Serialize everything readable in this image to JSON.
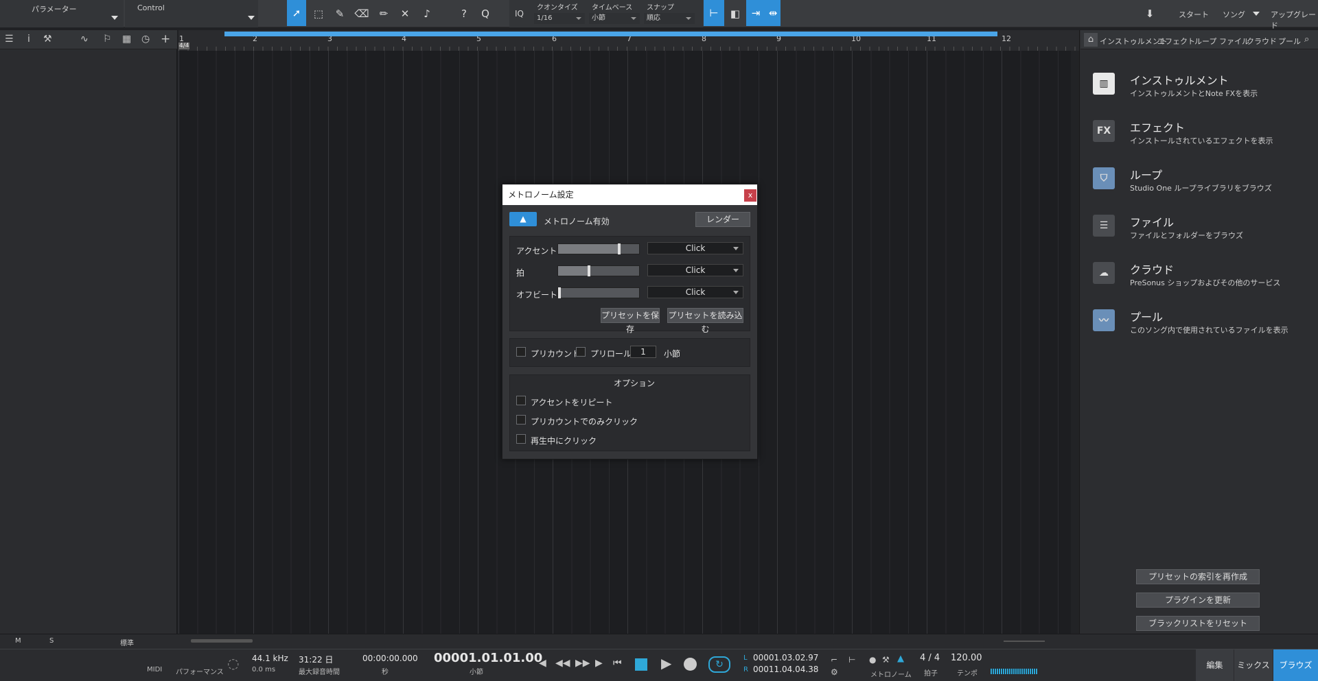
{
  "top": {
    "param_label": "パラメーター",
    "control_label": "Control",
    "iq": "IQ",
    "quantize_label": "クオンタイズ",
    "quantize_value": "1/16",
    "timebase_label": "タイムベース",
    "timebase_value": "小節",
    "snap_label": "スナップ",
    "snap_value": "順応",
    "help": "?",
    "q": "Q",
    "start": "スタート",
    "song": "ソング",
    "upgrade": "アップグレード"
  },
  "ruler": {
    "bars": [
      "1",
      "2",
      "3",
      "4",
      "5",
      "6",
      "7",
      "8",
      "9",
      "10",
      "11",
      "12"
    ],
    "timesig": "4/4"
  },
  "browser": {
    "tabs": [
      "インストゥルメント",
      "エフェクト",
      "ループ",
      "ファイル",
      "クラウド",
      "プール"
    ],
    "items": [
      {
        "title": "インストゥルメント",
        "desc": "インストゥルメントとNote FXを表示",
        "icon": "piano-icon"
      },
      {
        "title": "エフェクト",
        "desc": "インストールされているエフェクトを表示",
        "icon": "fx-icon",
        "icon_text": "FX"
      },
      {
        "title": "ループ",
        "desc": "Studio One ループライブラリをブラウズ",
        "icon": "loop-icon"
      },
      {
        "title": "ファイル",
        "desc": "ファイルとフォルダーをブラウズ",
        "icon": "file-icon"
      },
      {
        "title": "クラウド",
        "desc": "PreSonus ショップおよびその他のサービス",
        "icon": "cloud-icon"
      },
      {
        "title": "プール",
        "desc": "このソング内で使用されているファイルを表示",
        "icon": "pool-icon"
      }
    ],
    "buttons": [
      "プリセットの索引を再作成",
      "プラグインを更新",
      "ブラックリストをリセット"
    ]
  },
  "dialog": {
    "title": "メトロノーム設定",
    "close": "x",
    "enable_label": "メトロノーム有効",
    "render": "レンダー",
    "rows": [
      {
        "label": "アクセント",
        "sound": "Click",
        "level": 0.78
      },
      {
        "label": "拍",
        "sound": "Click",
        "level": 0.38
      },
      {
        "label": "オフビート",
        "sound": "Click",
        "level": 0.0
      }
    ],
    "save_preset": "プリセットを保存",
    "load_preset": "プリセットを読み込む",
    "precount": "プリカウント",
    "preroll": "プリロール",
    "preroll_value": "1",
    "bars_label": "小節",
    "options_title": "オプション",
    "options": [
      "アクセントをリピート",
      "プリカウントでのみクリック",
      "再生中にクリック"
    ]
  },
  "bottom": {
    "m": "M",
    "s": "S",
    "std": "標準"
  },
  "transport": {
    "midi": "MIDI",
    "performance": "パフォーマンス",
    "rate": "44.1 kHz",
    "latency": "0.0 ms",
    "rec_time": "31:22 日",
    "rec_time_label": "最大録音時間",
    "time_sec": "00:00:00.000",
    "sec_label": "秒",
    "position": "00001.01.01.00",
    "pos_label": "小節",
    "l_label": "L",
    "l_value": "00001.03.02.97",
    "r_label": "R",
    "r_value": "00011.04.04.38",
    "metronome_label": "メトロノーム",
    "timesig": "4 / 4",
    "timesig_label": "拍子",
    "tempo": "120.00",
    "tempo_label": "テンポ",
    "edit": "編集",
    "mix": "ミックス",
    "browse": "ブラウズ"
  },
  "colors": {
    "accent": "#2f8fd8",
    "close": "#c7414b"
  }
}
